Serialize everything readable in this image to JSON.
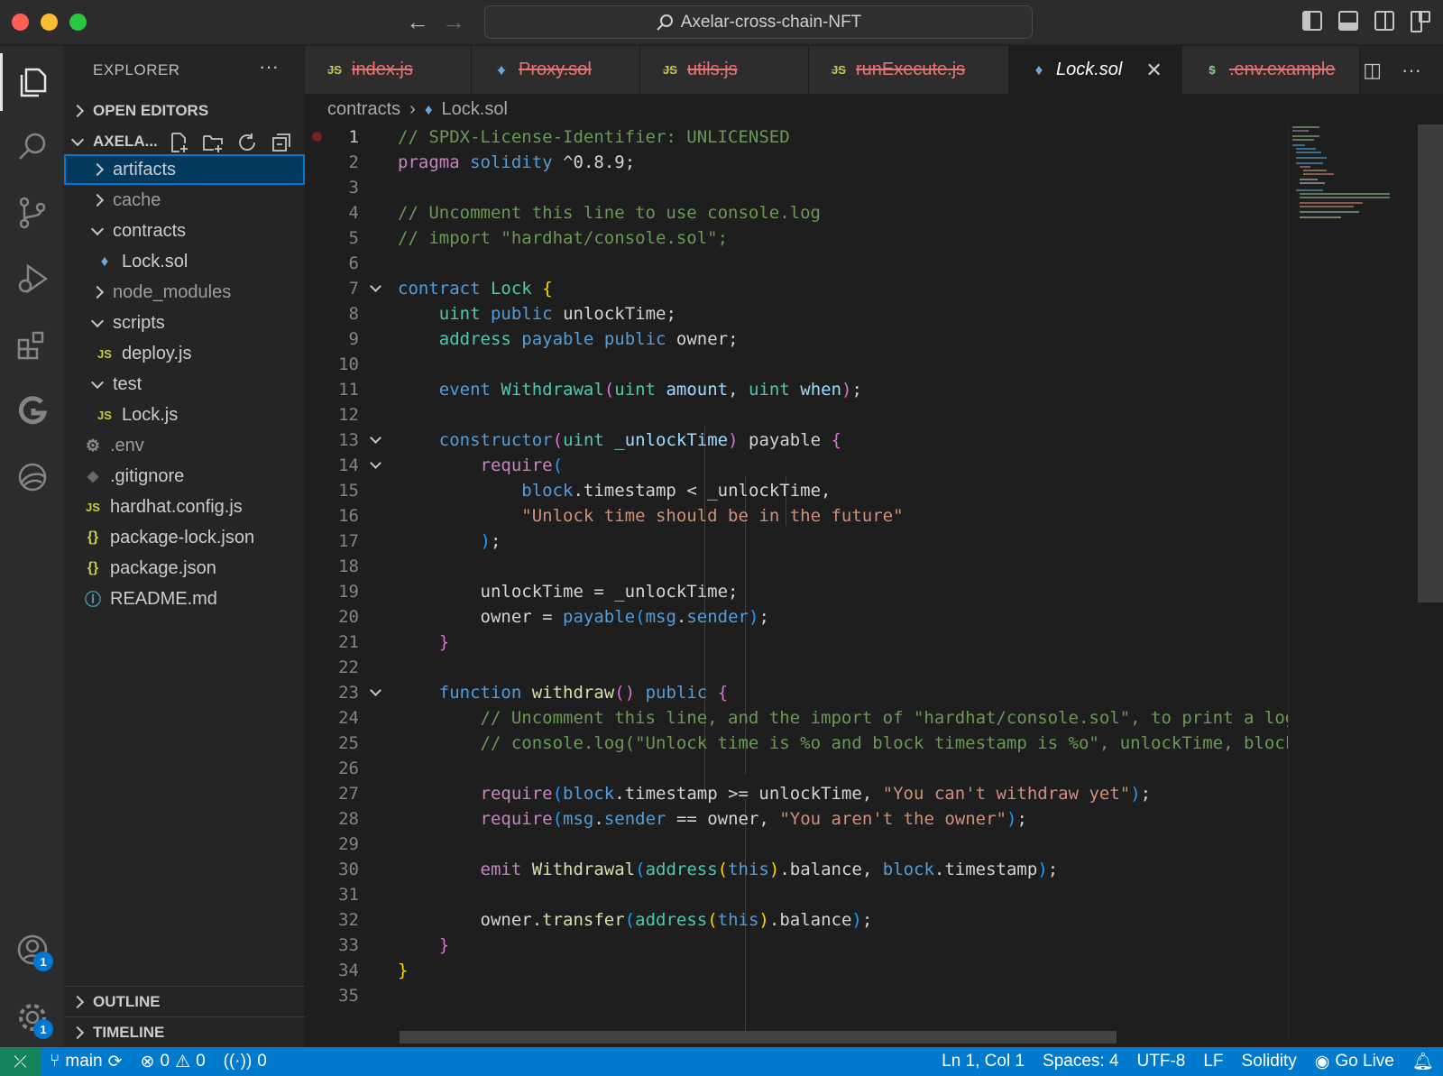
{
  "window": {
    "title": "Axelar-cross-chain-NFT"
  },
  "sidebar": {
    "title": "EXPLORER",
    "open_editors": "OPEN EDITORS",
    "folder": "AXELA...",
    "items": [
      {
        "label": "artifacts",
        "type": "folder",
        "expanded": false
      },
      {
        "label": "cache",
        "type": "folder",
        "expanded": false
      },
      {
        "label": "contracts",
        "type": "folder",
        "expanded": true
      },
      {
        "label": "Lock.sol",
        "type": "sol"
      },
      {
        "label": "node_modules",
        "type": "folder",
        "expanded": false
      },
      {
        "label": "scripts",
        "type": "folder",
        "expanded": true
      },
      {
        "label": "deploy.js",
        "type": "js"
      },
      {
        "label": "test",
        "type": "folder",
        "expanded": true
      },
      {
        "label": "Lock.js",
        "type": "js"
      },
      {
        "label": ".env",
        "type": "gear"
      },
      {
        "label": ".gitignore",
        "type": "git"
      },
      {
        "label": "hardhat.config.js",
        "type": "js"
      },
      {
        "label": "package-lock.json",
        "type": "json"
      },
      {
        "label": "package.json",
        "type": "json"
      },
      {
        "label": "README.md",
        "type": "info"
      }
    ],
    "outline": "OUTLINE",
    "timeline": "TIMELINE"
  },
  "tabs": [
    {
      "label": "index.js",
      "icon": "JS"
    },
    {
      "label": "Proxy.sol",
      "icon": "♦"
    },
    {
      "label": "utils.js",
      "icon": "JS"
    },
    {
      "label": "runExecute.js",
      "icon": "JS"
    },
    {
      "label": "Lock.sol",
      "icon": "♦"
    },
    {
      "label": ".env.example",
      "icon": "$"
    }
  ],
  "breadcrumb": {
    "folder": "contracts",
    "file": "Lock.sol"
  },
  "editor": {
    "line_numbers": [
      "1",
      "2",
      "3",
      "4",
      "5",
      "6",
      "7",
      "8",
      "9",
      "10",
      "11",
      "12",
      "13",
      "14",
      "15",
      "16",
      "17",
      "18",
      "19",
      "20",
      "21",
      "22",
      "23",
      "24",
      "25",
      "26",
      "27",
      "28",
      "29",
      "30",
      "31",
      "32",
      "33",
      "34",
      "35"
    ]
  },
  "statusbar": {
    "branch": "main",
    "errors": "0",
    "warnings": "0",
    "ports": "0",
    "position": "Ln 1, Col 1",
    "spaces": "Spaces: 4",
    "encoding": "UTF-8",
    "eol": "LF",
    "language": "Solidity",
    "golive": "Go Live"
  },
  "badges": {
    "accounts": "1",
    "settings": "1"
  },
  "colors": {
    "accent": "#007acc",
    "keyword": "#569cd6",
    "comment": "#6a9955",
    "string": "#ce9178",
    "type": "#4ec9b0"
  }
}
